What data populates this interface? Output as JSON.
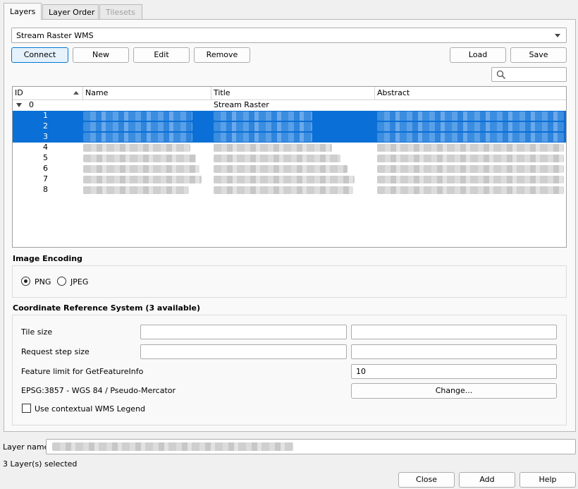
{
  "tabs": [
    {
      "label": "Layers",
      "active": true
    },
    {
      "label": "Layer Order",
      "active": false
    },
    {
      "label": "Tilesets",
      "active": false,
      "disabled": true
    }
  ],
  "connection": {
    "selected": "Stream Raster WMS"
  },
  "buttons": {
    "connect": "Connect",
    "new": "New",
    "edit": "Edit",
    "remove": "Remove",
    "load": "Load",
    "save": "Save"
  },
  "search": {
    "placeholder": ""
  },
  "tree": {
    "columns": [
      "ID",
      "Name",
      "Title",
      "Abstract"
    ],
    "root": {
      "id": "0",
      "title": "Stream Raster"
    },
    "rows": [
      {
        "id": "1",
        "selected": true
      },
      {
        "id": "2",
        "selected": true
      },
      {
        "id": "3",
        "selected": true
      },
      {
        "id": "4",
        "selected": false
      },
      {
        "id": "5",
        "selected": false
      },
      {
        "id": "6",
        "selected": false
      },
      {
        "id": "7",
        "selected": false
      },
      {
        "id": "8",
        "selected": false
      }
    ]
  },
  "encoding": {
    "title": "Image Encoding",
    "options": [
      {
        "label": "PNG",
        "checked": true
      },
      {
        "label": "JPEG",
        "checked": false
      }
    ]
  },
  "crs": {
    "title": "Coordinate Reference System (3 available)",
    "tile_size_label": "Tile size",
    "tile_size_w": "",
    "tile_size_h": "",
    "request_step_label": "Request step size",
    "request_step_w": "",
    "request_step_h": "",
    "feature_limit_label": "Feature limit for GetFeatureInfo",
    "feature_limit_value": "10",
    "crs_label": "EPSG:3857 - WGS 84 / Pseudo-Mercator",
    "change_button": "Change...",
    "contextual_legend_label": "Use contextual WMS Legend",
    "contextual_legend_checked": false
  },
  "layer_name": {
    "label": "Layer name",
    "value": ""
  },
  "status": {
    "text": "3 Layer(s) selected"
  },
  "footer": {
    "close": "Close",
    "add": "Add",
    "help": "Help"
  },
  "colors": {
    "selection": "#0a6fd6",
    "accent": "#0078d7"
  }
}
